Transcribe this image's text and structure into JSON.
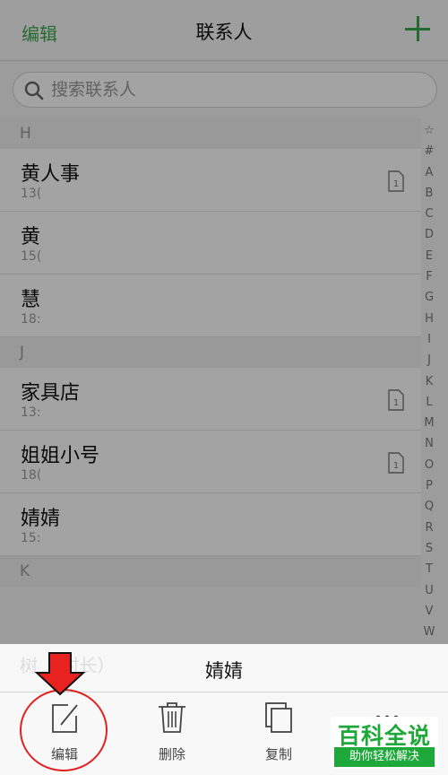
{
  "header": {
    "edit_label": "编辑",
    "title": "联系人"
  },
  "search": {
    "placeholder": "搜索联系人"
  },
  "sections": [
    {
      "letter": "H",
      "contacts": [
        {
          "name": "黄人事",
          "phone": "13(",
          "sim": true
        },
        {
          "name": "黄",
          "phone": "15(",
          "sim": false
        },
        {
          "name": "慧",
          "phone": "18:",
          "sim": false
        }
      ]
    },
    {
      "letter": "J",
      "contacts": [
        {
          "name": "家具店",
          "phone": "13:",
          "sim": true
        },
        {
          "name": "姐姐小号",
          "phone": "18(",
          "sim": true
        },
        {
          "name": "婧婧",
          "phone": "15:",
          "sim": false
        }
      ]
    },
    {
      "letter": "K",
      "contacts": []
    }
  ],
  "index_bar": [
    "☆",
    "#",
    "A",
    "B",
    "C",
    "D",
    "E",
    "F",
    "G",
    "H",
    "I",
    "J",
    "K",
    "L",
    "M",
    "N",
    "O",
    "P",
    "Q",
    "R",
    "S",
    "T",
    "U",
    "V",
    "W"
  ],
  "sheet": {
    "peek_text": "树    （村长）",
    "title": "婧婧",
    "actions": {
      "edit": "编辑",
      "delete": "删除",
      "copy": "复制"
    }
  },
  "watermark": {
    "main": "百科全说",
    "sub": "助你轻松解决"
  },
  "colors": {
    "accent": "#3aa64a",
    "annotation": "#e02020",
    "watermark": "#1ea83a"
  }
}
